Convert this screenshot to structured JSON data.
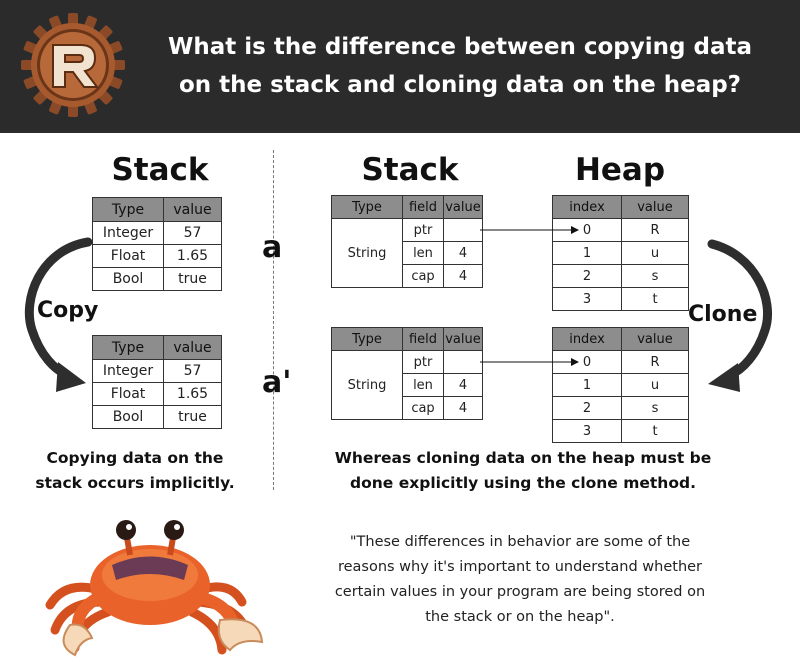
{
  "header": {
    "title": "What is the difference between copying data\non the stack and cloning data on the heap?"
  },
  "headings": {
    "left_stack": "Stack",
    "right_stack": "Stack",
    "heap": "Heap"
  },
  "copy_side": {
    "label": "Copy",
    "columns": [
      "Type",
      "value"
    ],
    "rows": [
      [
        "Integer",
        "57"
      ],
      [
        "Float",
        "1.65"
      ],
      [
        "Bool",
        "true"
      ]
    ],
    "caption": "Copying data on the\nstack occurs implicitly."
  },
  "clone_side": {
    "label": "Clone",
    "var_a": "a",
    "var_a_prime": "a'",
    "stack_columns": [
      "Type",
      "field",
      "value"
    ],
    "stack_type": "String",
    "stack_rows": [
      [
        "ptr",
        ""
      ],
      [
        "len",
        "4"
      ],
      [
        "cap",
        "4"
      ]
    ],
    "heap_columns": [
      "index",
      "value"
    ],
    "heap_rows": [
      [
        "0",
        "R"
      ],
      [
        "1",
        "u"
      ],
      [
        "2",
        "s"
      ],
      [
        "3",
        "t"
      ]
    ],
    "caption": "Whereas cloning data on the heap must be\ndone explicitly using the clone method."
  },
  "quote": "\"These differences in behavior are some of the\nreasons why it's important to understand whether\ncertain values in your program are being stored on\nthe stack or on the heap\".",
  "colors": {
    "header_bg": "#2b2b2b",
    "table_header": "#8d8d8d",
    "arrow": "#2e2e2e",
    "crab": "#e8622a",
    "rust_logo": "#a65a2e"
  }
}
